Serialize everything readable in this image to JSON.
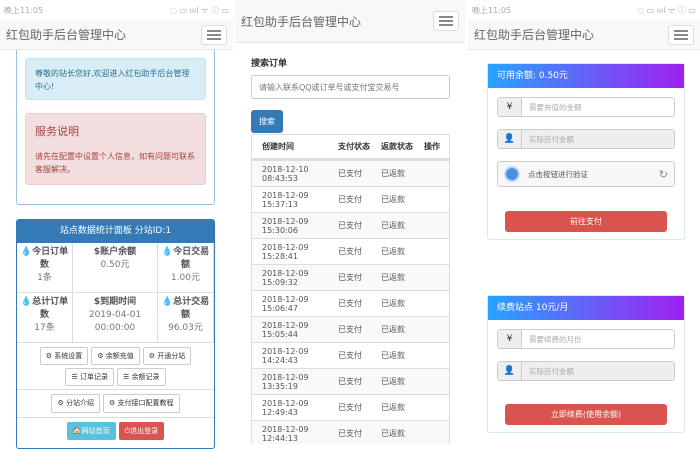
{
  "app_title": "红包助手后台管理中心",
  "status_time": "晚上11:05",
  "status_icons": "◌ ▭ ıııl ᯤ ⓘ ▭",
  "home": {
    "welcome": "尊敬的站长您好,欢迎进入红包助手后台管理中心!",
    "service_title": "服务说明",
    "service_text": "请先在配置中设置个人信息，如有问题可联系客服解决。",
    "stats_title": "站点数据统计面板 分站ID:1",
    "stats": [
      {
        "icon": "💧",
        "label": "今日订单数",
        "value": "1条"
      },
      {
        "icon": "$",
        "label": "账户余额",
        "value": "0.50元"
      },
      {
        "icon": "💧",
        "label": "今日交易额",
        "value": "1.00元"
      },
      {
        "icon": "💧",
        "label": "总计订单数",
        "value": "17条"
      },
      {
        "icon": "$",
        "label": "到期时间",
        "value": "2019-04-01 00:00:00"
      },
      {
        "icon": "💧",
        "label": "总计交易额",
        "value": "96.03元"
      }
    ],
    "buttons": [
      "系统设置",
      "余额充值",
      "开通分站",
      "订单记录",
      "余额记录",
      "分站介绍",
      "支付接口配置教程"
    ],
    "home_btn": "网站首页",
    "logout_btn": "退出登录"
  },
  "orders": {
    "search_label": "搜索订单",
    "search_placeholder": "请输入联系QQ或订单号或支付宝交易号",
    "search_btn": "搜索",
    "columns": [
      "创建时间",
      "支付状态",
      "返款状态",
      "操作"
    ],
    "rows": [
      [
        "2018-12-10 08:43:53",
        "已支付",
        "已返款"
      ],
      [
        "2018-12-09 15:37:13",
        "已支付",
        "已返款"
      ],
      [
        "2018-12-09 15:30:06",
        "已支付",
        "已返款"
      ],
      [
        "2018-12-09 15:28:41",
        "已支付",
        "已返款"
      ],
      [
        "2018-12-09 15:09:32",
        "已支付",
        "已返款"
      ],
      [
        "2018-12-09 15:06:47",
        "已支付",
        "已返款"
      ],
      [
        "2018-12-09 15:05:44",
        "已支付",
        "已返款"
      ],
      [
        "2018-12-09 14:24:43",
        "已支付",
        "已返款"
      ],
      [
        "2018-12-09 13:35:19",
        "已支付",
        "已返款"
      ],
      [
        "2018-12-09 12:49:43",
        "已支付",
        "已返款"
      ],
      [
        "2018-12-09 12:44:13",
        "已支付",
        "已返款"
      ]
    ]
  },
  "recharge": {
    "title": "可用余额: 0.50元",
    "amount_placeholder": "需要充值的金额",
    "pay_placeholder": "实际应付金额",
    "captcha": "点击按钮进行验证",
    "submit": "前往支付"
  },
  "renew": {
    "title": "续费站点 10元/月",
    "months_placeholder": "需要续费的月份",
    "pay_placeholder": "实际应付金额",
    "submit": "立即续费(使用余额)"
  }
}
